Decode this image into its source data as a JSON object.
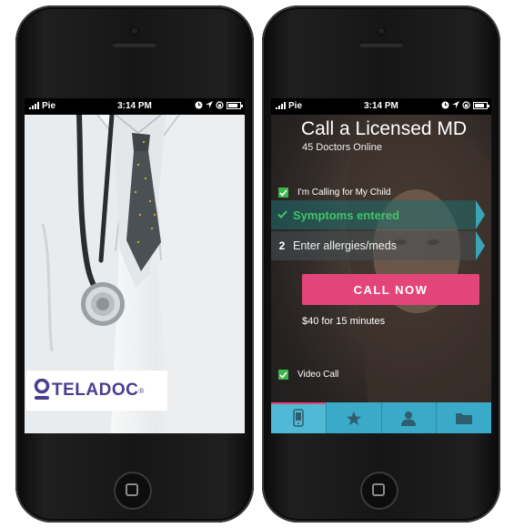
{
  "status": {
    "carrier": "Pie",
    "time": "3:14 PM"
  },
  "left_screen": {
    "logo_text": "TELADOC",
    "logo_mark": "®"
  },
  "app": {
    "title": "Call a Licensed MD",
    "doctors_online": "45 Doctors Online",
    "calling_for_child": "I'm Calling for My Child",
    "step1_label": "Symptoms entered",
    "step2_number": "2",
    "step2_label": "Enter allergies/meds",
    "call_button": "CALL NOW",
    "price": "$40 for 15 minutes",
    "video_call": "Video Call",
    "accent_color": "#e3457b",
    "tab_color": "#3ba9c8",
    "check_color": "#3fb44a"
  },
  "tabs": [
    {
      "icon": "phone-icon"
    },
    {
      "icon": "star-icon"
    },
    {
      "icon": "person-icon"
    },
    {
      "icon": "folder-icon"
    }
  ]
}
